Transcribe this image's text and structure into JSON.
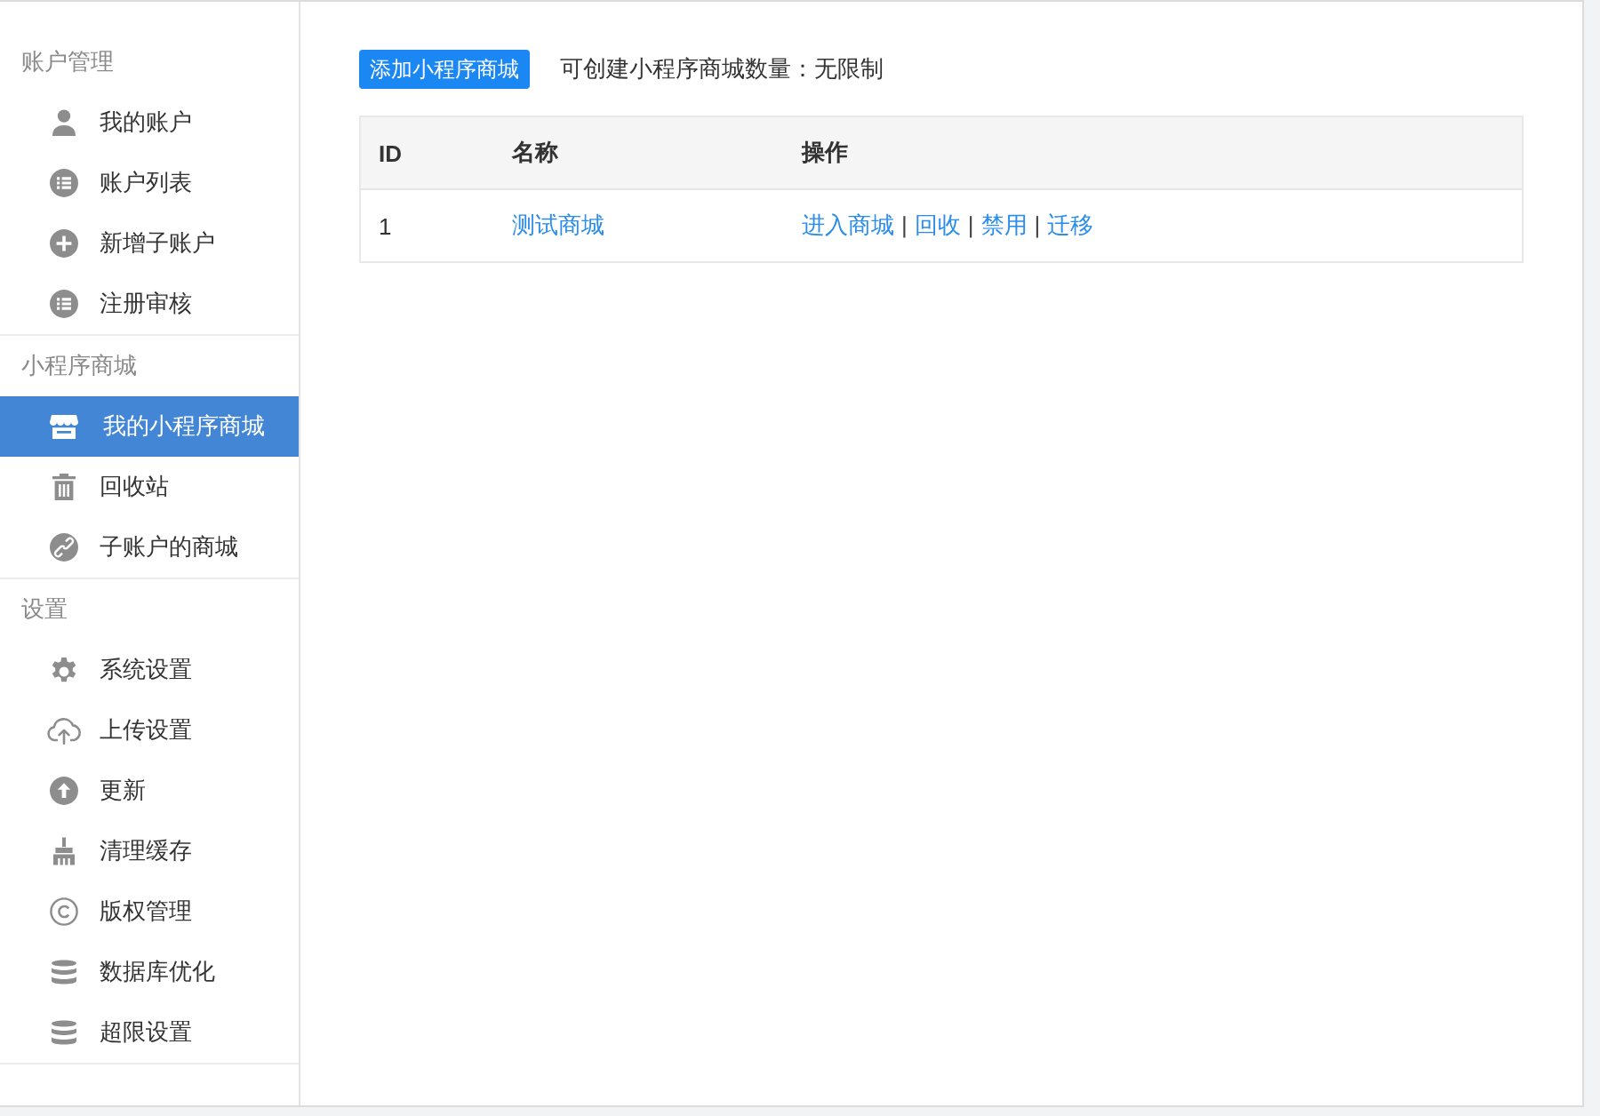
{
  "sidebar": {
    "groups": [
      {
        "title": "账户管理",
        "items": [
          {
            "label": "我的账户",
            "selected": false
          },
          {
            "label": "账户列表",
            "selected": false
          },
          {
            "label": "新增子账户",
            "selected": false
          },
          {
            "label": "注册审核",
            "selected": false
          }
        ]
      },
      {
        "title": "小程序商城",
        "items": [
          {
            "label": "我的小程序商城",
            "selected": true
          },
          {
            "label": "回收站",
            "selected": false
          },
          {
            "label": "子账户的商城",
            "selected": false
          }
        ]
      },
      {
        "title": "设置",
        "items": [
          {
            "label": "系统设置",
            "selected": false
          },
          {
            "label": "上传设置",
            "selected": false
          },
          {
            "label": "更新",
            "selected": false
          },
          {
            "label": "清理缓存",
            "selected": false
          },
          {
            "label": "版权管理",
            "selected": false
          },
          {
            "label": "数据库优化",
            "selected": false
          },
          {
            "label": "超限设置",
            "selected": false
          }
        ]
      }
    ]
  },
  "toolbar": {
    "add_button": "添加小程序商城",
    "quota": "可创建小程序商城数量：无限制"
  },
  "table": {
    "columns": [
      "ID",
      "名称",
      "操作"
    ],
    "rows": [
      {
        "id": "1",
        "name": "测试商城",
        "actions": [
          {
            "kind": "link",
            "text": "进入商城"
          },
          {
            "kind": "separator",
            "text": "|"
          },
          {
            "kind": "link",
            "text": "回收"
          },
          {
            "kind": "separator",
            "text": "|"
          },
          {
            "kind": "link",
            "text": "禁用"
          },
          {
            "kind": "separator",
            "text": "|"
          },
          {
            "kind": "link",
            "text": "迁移"
          }
        ]
      }
    ]
  }
}
